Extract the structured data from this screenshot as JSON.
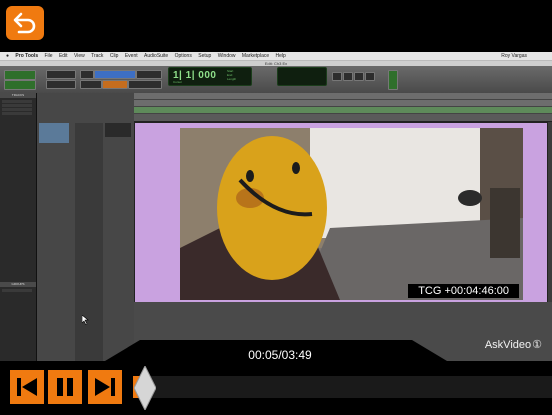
{
  "player": {
    "elapsed_time": "00:05/03:49",
    "progress": 0.022,
    "watermark": "AskVideo"
  },
  "mac_menu": {
    "items": [
      "Pro Tools",
      "File",
      "Edit",
      "View",
      "Track",
      "Clip",
      "Event",
      "AudioSuite",
      "Options",
      "Setup",
      "Window",
      "Marketplace",
      "Help"
    ],
    "user": "Roy Vargas"
  },
  "window": {
    "title": "Edit: Ch3 Ex"
  },
  "counter": {
    "main": "1| 1| 000",
    "sub": "Cursor",
    "start": "Start",
    "end": "End",
    "length": "Length"
  },
  "panels": {
    "tracks": "TRACKS",
    "groups": "GROUPS"
  },
  "video": {
    "timecode": "TCG +00:04:46:00"
  },
  "colors": {
    "accent": "#f07a10",
    "clip": "#c9a2e0"
  }
}
